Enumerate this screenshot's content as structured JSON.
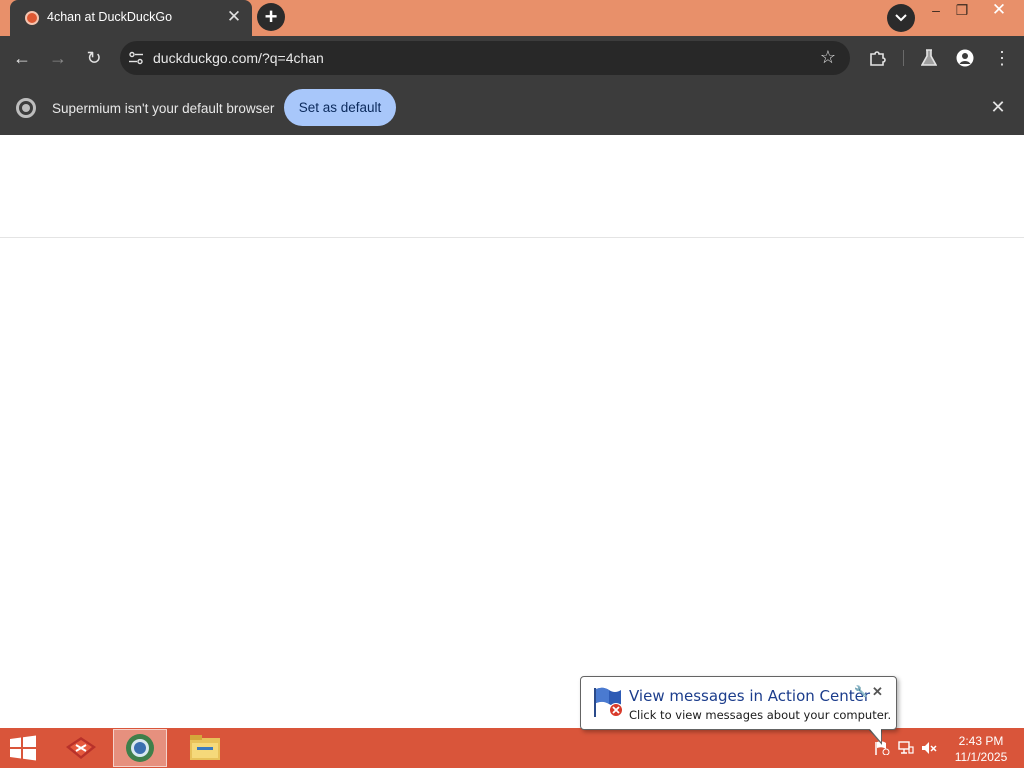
{
  "window": {
    "minimize_glyph": "–",
    "restore_glyph": "❐",
    "close_glyph": "✕"
  },
  "tab": {
    "title": "4chan at DuckDuckGo",
    "close_glyph": "✕",
    "favicon": "duckduckgo-icon"
  },
  "tabstrip": {
    "new_tab_glyph": "+"
  },
  "toolbar": {
    "url": "duckduckgo.com/?q=4chan",
    "back_glyph": "←",
    "forward_glyph": "→",
    "reload_glyph": "↻",
    "bookmark_glyph": "☆",
    "menu_glyph": "⋮"
  },
  "infobar": {
    "message": "Supermium isn't your default browser",
    "button_label": "Set as default",
    "close_glyph": "✕"
  },
  "notification": {
    "title": "View messages in Action Center",
    "text": "Click to view messages about your computer.",
    "options_glyph": "🔧",
    "close_glyph": "✕"
  },
  "taskbar": {
    "clock_time": "2:43 PM",
    "clock_date": "11/1/2025",
    "apps": [
      "app-icon",
      "supermium-icon",
      "file-explorer-icon"
    ]
  },
  "colors": {
    "titlebar": "#e8906a",
    "chrome_dark": "#3c3c3c",
    "button_accent": "#a8c7fa",
    "taskbar": "#d9553a",
    "balloon_title": "#1c3d8c"
  }
}
